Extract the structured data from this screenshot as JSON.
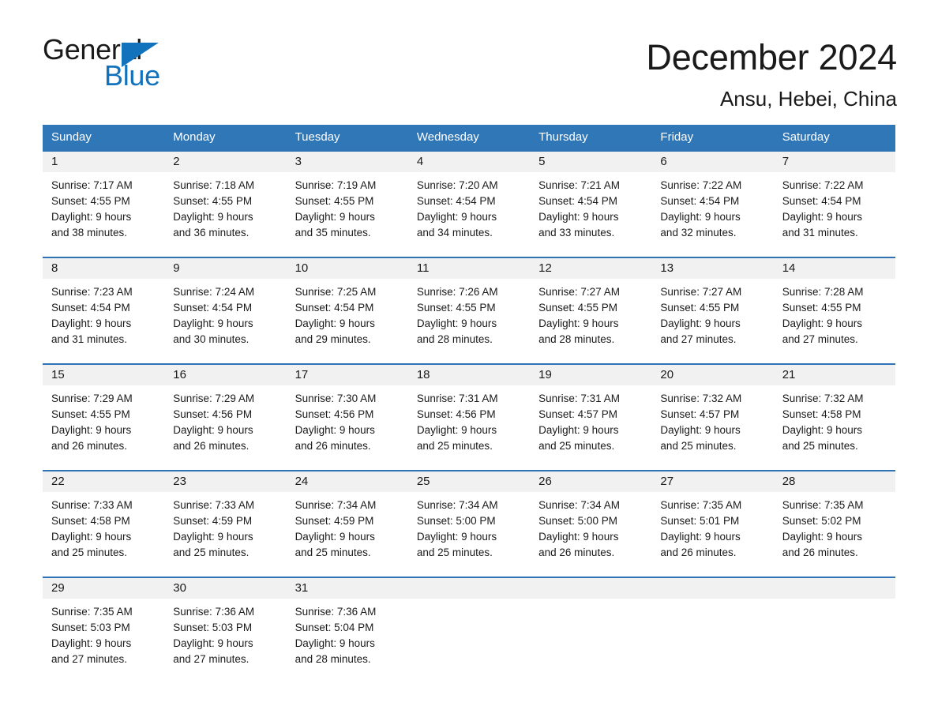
{
  "brand": {
    "name_part1": "General",
    "name_part2": "Blue"
  },
  "header": {
    "title": "December 2024",
    "subtitle": "Ansu, Hebei, China"
  },
  "colors": {
    "header_blue": "#3077b8",
    "row_rule_blue": "#2e74b5",
    "daynum_band": "#f1f1f1",
    "brand_blue": "#1272bc",
    "text": "#1a1a1a"
  },
  "weekdays": [
    "Sunday",
    "Monday",
    "Tuesday",
    "Wednesday",
    "Thursday",
    "Friday",
    "Saturday"
  ],
  "labels": {
    "sunrise_prefix": "Sunrise:",
    "sunset_prefix": "Sunset:",
    "daylight_prefix": "Daylight:"
  },
  "weeks": [
    {
      "days": [
        {
          "date": "1",
          "sunrise": "Sunrise: 7:17 AM",
          "sunset": "Sunset: 4:55 PM",
          "daylight_line1": "Daylight: 9 hours",
          "daylight_line2": "and 38 minutes."
        },
        {
          "date": "2",
          "sunrise": "Sunrise: 7:18 AM",
          "sunset": "Sunset: 4:55 PM",
          "daylight_line1": "Daylight: 9 hours",
          "daylight_line2": "and 36 minutes."
        },
        {
          "date": "3",
          "sunrise": "Sunrise: 7:19 AM",
          "sunset": "Sunset: 4:55 PM",
          "daylight_line1": "Daylight: 9 hours",
          "daylight_line2": "and 35 minutes."
        },
        {
          "date": "4",
          "sunrise": "Sunrise: 7:20 AM",
          "sunset": "Sunset: 4:54 PM",
          "daylight_line1": "Daylight: 9 hours",
          "daylight_line2": "and 34 minutes."
        },
        {
          "date": "5",
          "sunrise": "Sunrise: 7:21 AM",
          "sunset": "Sunset: 4:54 PM",
          "daylight_line1": "Daylight: 9 hours",
          "daylight_line2": "and 33 minutes."
        },
        {
          "date": "6",
          "sunrise": "Sunrise: 7:22 AM",
          "sunset": "Sunset: 4:54 PM",
          "daylight_line1": "Daylight: 9 hours",
          "daylight_line2": "and 32 minutes."
        },
        {
          "date": "7",
          "sunrise": "Sunrise: 7:22 AM",
          "sunset": "Sunset: 4:54 PM",
          "daylight_line1": "Daylight: 9 hours",
          "daylight_line2": "and 31 minutes."
        }
      ]
    },
    {
      "days": [
        {
          "date": "8",
          "sunrise": "Sunrise: 7:23 AM",
          "sunset": "Sunset: 4:54 PM",
          "daylight_line1": "Daylight: 9 hours",
          "daylight_line2": "and 31 minutes."
        },
        {
          "date": "9",
          "sunrise": "Sunrise: 7:24 AM",
          "sunset": "Sunset: 4:54 PM",
          "daylight_line1": "Daylight: 9 hours",
          "daylight_line2": "and 30 minutes."
        },
        {
          "date": "10",
          "sunrise": "Sunrise: 7:25 AM",
          "sunset": "Sunset: 4:54 PM",
          "daylight_line1": "Daylight: 9 hours",
          "daylight_line2": "and 29 minutes."
        },
        {
          "date": "11",
          "sunrise": "Sunrise: 7:26 AM",
          "sunset": "Sunset: 4:55 PM",
          "daylight_line1": "Daylight: 9 hours",
          "daylight_line2": "and 28 minutes."
        },
        {
          "date": "12",
          "sunrise": "Sunrise: 7:27 AM",
          "sunset": "Sunset: 4:55 PM",
          "daylight_line1": "Daylight: 9 hours",
          "daylight_line2": "and 28 minutes."
        },
        {
          "date": "13",
          "sunrise": "Sunrise: 7:27 AM",
          "sunset": "Sunset: 4:55 PM",
          "daylight_line1": "Daylight: 9 hours",
          "daylight_line2": "and 27 minutes."
        },
        {
          "date": "14",
          "sunrise": "Sunrise: 7:28 AM",
          "sunset": "Sunset: 4:55 PM",
          "daylight_line1": "Daylight: 9 hours",
          "daylight_line2": "and 27 minutes."
        }
      ]
    },
    {
      "days": [
        {
          "date": "15",
          "sunrise": "Sunrise: 7:29 AM",
          "sunset": "Sunset: 4:55 PM",
          "daylight_line1": "Daylight: 9 hours",
          "daylight_line2": "and 26 minutes."
        },
        {
          "date": "16",
          "sunrise": "Sunrise: 7:29 AM",
          "sunset": "Sunset: 4:56 PM",
          "daylight_line1": "Daylight: 9 hours",
          "daylight_line2": "and 26 minutes."
        },
        {
          "date": "17",
          "sunrise": "Sunrise: 7:30 AM",
          "sunset": "Sunset: 4:56 PM",
          "daylight_line1": "Daylight: 9 hours",
          "daylight_line2": "and 26 minutes."
        },
        {
          "date": "18",
          "sunrise": "Sunrise: 7:31 AM",
          "sunset": "Sunset: 4:56 PM",
          "daylight_line1": "Daylight: 9 hours",
          "daylight_line2": "and 25 minutes."
        },
        {
          "date": "19",
          "sunrise": "Sunrise: 7:31 AM",
          "sunset": "Sunset: 4:57 PM",
          "daylight_line1": "Daylight: 9 hours",
          "daylight_line2": "and 25 minutes."
        },
        {
          "date": "20",
          "sunrise": "Sunrise: 7:32 AM",
          "sunset": "Sunset: 4:57 PM",
          "daylight_line1": "Daylight: 9 hours",
          "daylight_line2": "and 25 minutes."
        },
        {
          "date": "21",
          "sunrise": "Sunrise: 7:32 AM",
          "sunset": "Sunset: 4:58 PM",
          "daylight_line1": "Daylight: 9 hours",
          "daylight_line2": "and 25 minutes."
        }
      ]
    },
    {
      "days": [
        {
          "date": "22",
          "sunrise": "Sunrise: 7:33 AM",
          "sunset": "Sunset: 4:58 PM",
          "daylight_line1": "Daylight: 9 hours",
          "daylight_line2": "and 25 minutes."
        },
        {
          "date": "23",
          "sunrise": "Sunrise: 7:33 AM",
          "sunset": "Sunset: 4:59 PM",
          "daylight_line1": "Daylight: 9 hours",
          "daylight_line2": "and 25 minutes."
        },
        {
          "date": "24",
          "sunrise": "Sunrise: 7:34 AM",
          "sunset": "Sunset: 4:59 PM",
          "daylight_line1": "Daylight: 9 hours",
          "daylight_line2": "and 25 minutes."
        },
        {
          "date": "25",
          "sunrise": "Sunrise: 7:34 AM",
          "sunset": "Sunset: 5:00 PM",
          "daylight_line1": "Daylight: 9 hours",
          "daylight_line2": "and 25 minutes."
        },
        {
          "date": "26",
          "sunrise": "Sunrise: 7:34 AM",
          "sunset": "Sunset: 5:00 PM",
          "daylight_line1": "Daylight: 9 hours",
          "daylight_line2": "and 26 minutes."
        },
        {
          "date": "27",
          "sunrise": "Sunrise: 7:35 AM",
          "sunset": "Sunset: 5:01 PM",
          "daylight_line1": "Daylight: 9 hours",
          "daylight_line2": "and 26 minutes."
        },
        {
          "date": "28",
          "sunrise": "Sunrise: 7:35 AM",
          "sunset": "Sunset: 5:02 PM",
          "daylight_line1": "Daylight: 9 hours",
          "daylight_line2": "and 26 minutes."
        }
      ]
    },
    {
      "days": [
        {
          "date": "29",
          "sunrise": "Sunrise: 7:35 AM",
          "sunset": "Sunset: 5:03 PM",
          "daylight_line1": "Daylight: 9 hours",
          "daylight_line2": "and 27 minutes."
        },
        {
          "date": "30",
          "sunrise": "Sunrise: 7:36 AM",
          "sunset": "Sunset: 5:03 PM",
          "daylight_line1": "Daylight: 9 hours",
          "daylight_line2": "and 27 minutes."
        },
        {
          "date": "31",
          "sunrise": "Sunrise: 7:36 AM",
          "sunset": "Sunset: 5:04 PM",
          "daylight_line1": "Daylight: 9 hours",
          "daylight_line2": "and 28 minutes."
        },
        {
          "date": "",
          "sunrise": "",
          "sunset": "",
          "daylight_line1": "",
          "daylight_line2": ""
        },
        {
          "date": "",
          "sunrise": "",
          "sunset": "",
          "daylight_line1": "",
          "daylight_line2": ""
        },
        {
          "date": "",
          "sunrise": "",
          "sunset": "",
          "daylight_line1": "",
          "daylight_line2": ""
        },
        {
          "date": "",
          "sunrise": "",
          "sunset": "",
          "daylight_line1": "",
          "daylight_line2": ""
        }
      ]
    }
  ]
}
